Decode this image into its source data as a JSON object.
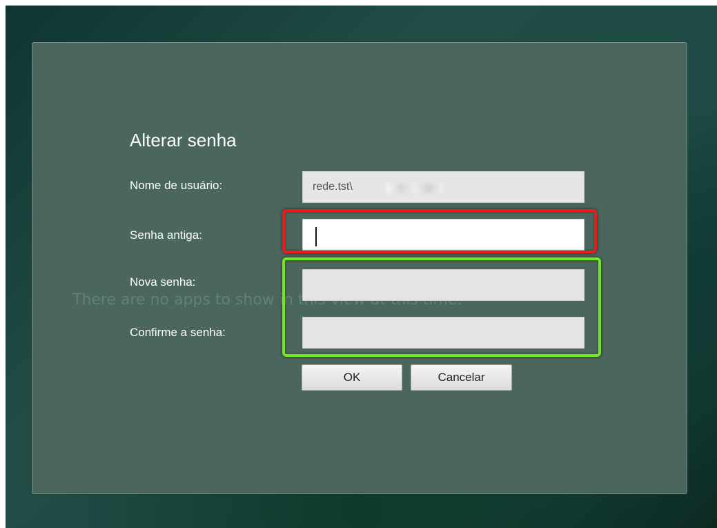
{
  "dialog": {
    "title": "Alterar senha",
    "background_message": "There are no apps to show in this view at this time."
  },
  "form": {
    "username": {
      "label": "Nome de usuário:",
      "value": "rede.tst\\"
    },
    "old_password": {
      "label": "Senha antiga:",
      "value": ""
    },
    "new_password": {
      "label": "Nova senha:",
      "value": ""
    },
    "confirm_password": {
      "label": "Confirme a senha:",
      "value": ""
    }
  },
  "buttons": {
    "ok": "OK",
    "cancel": "Cancelar"
  },
  "highlights": {
    "old_password_color": "#ee1b1b",
    "new_passwords_color": "#6fe81e"
  }
}
